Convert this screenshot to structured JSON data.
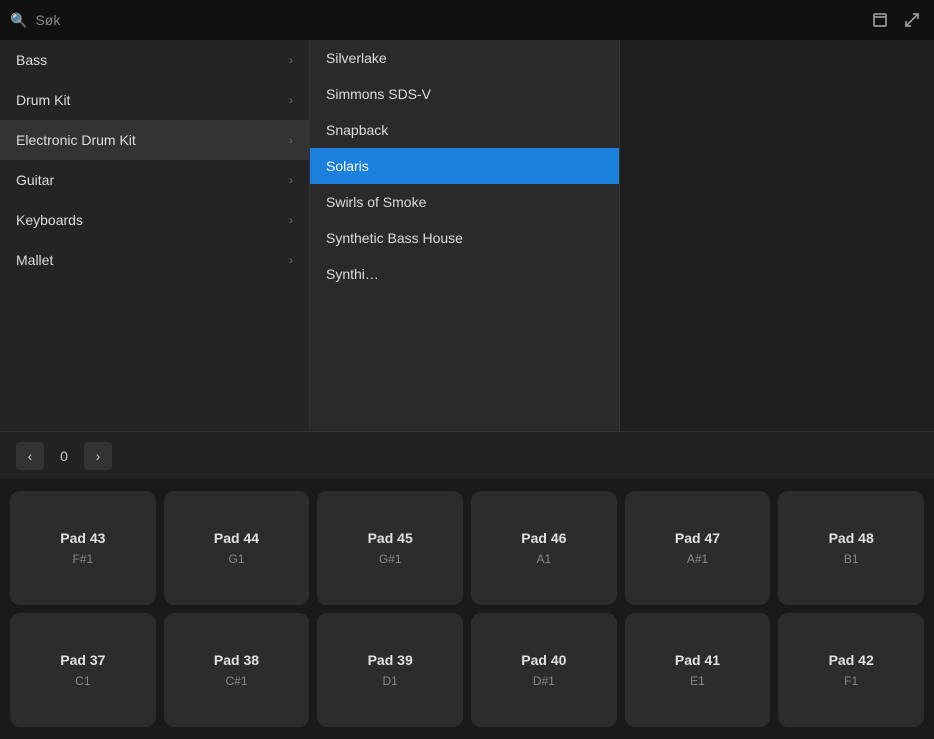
{
  "searchBar": {
    "placeholder": "Søk",
    "value": ""
  },
  "headerIcons": {
    "window": "▪",
    "collapse": "↗"
  },
  "sidebar": {
    "items": [
      {
        "label": "Bass",
        "hasChildren": true,
        "active": false
      },
      {
        "label": "Drum Kit",
        "hasChildren": true,
        "active": false
      },
      {
        "label": "Electronic Drum Kit",
        "hasChildren": true,
        "active": true
      },
      {
        "label": "Guitar",
        "hasChildren": true,
        "active": false
      },
      {
        "label": "Keyboards",
        "hasChildren": true,
        "active": false
      },
      {
        "label": "Mallet",
        "hasChildren": true,
        "active": false
      }
    ]
  },
  "dropdown": {
    "items": [
      {
        "label": "Silverlake",
        "selected": false
      },
      {
        "label": "Simmons SDS-V",
        "selected": false
      },
      {
        "label": "Snapback",
        "selected": false
      },
      {
        "label": "Solaris",
        "selected": true
      },
      {
        "label": "Swirls of Smoke",
        "selected": false
      },
      {
        "label": "Synthetic Bass House",
        "selected": false
      },
      {
        "label": "Synthi…",
        "selected": false
      }
    ]
  },
  "pagination": {
    "prev": "‹",
    "next": "›",
    "current": "0"
  },
  "padsRow1": [
    {
      "name": "Pad 43",
      "note": "F#1"
    },
    {
      "name": "Pad 44",
      "note": "G1"
    },
    {
      "name": "Pad 45",
      "note": "G#1"
    },
    {
      "name": "Pad 46",
      "note": "A1"
    },
    {
      "name": "Pad 47",
      "note": "A#1"
    },
    {
      "name": "Pad 48",
      "note": "B1"
    }
  ],
  "padsRow2": [
    {
      "name": "Pad 37",
      "note": "C1"
    },
    {
      "name": "Pad 38",
      "note": "C#1"
    },
    {
      "name": "Pad 39",
      "note": "D1"
    },
    {
      "name": "Pad 40",
      "note": "D#1"
    },
    {
      "name": "Pad 41",
      "note": "E1"
    },
    {
      "name": "Pad 42",
      "note": "F1"
    }
  ]
}
